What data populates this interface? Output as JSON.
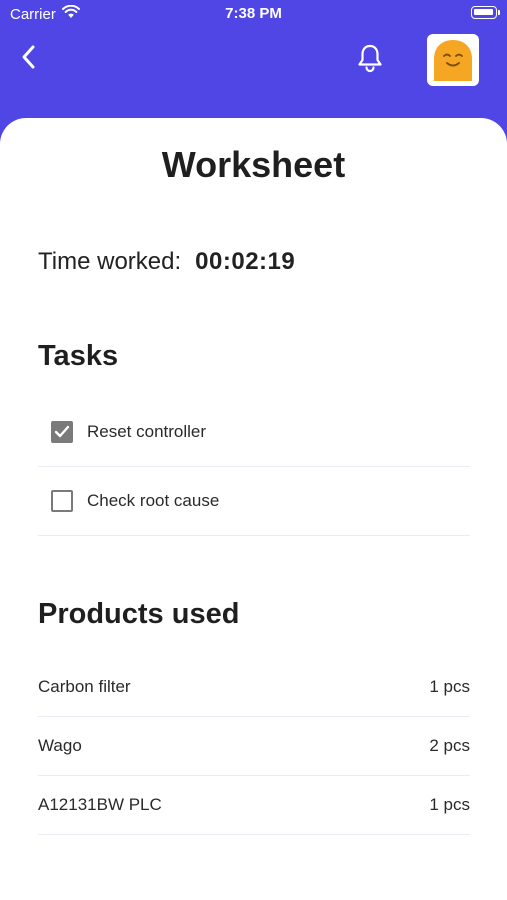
{
  "status_bar": {
    "carrier": "Carrier",
    "time": "7:38 PM",
    "icons": [
      "wifi-icon",
      "battery-icon"
    ]
  },
  "header": {
    "background_color": "#4f46e5",
    "back_icon": "chevron-left-icon",
    "notification_icon": "bell-icon",
    "avatar_color": "#f5a623"
  },
  "page": {
    "title": "Worksheet",
    "time_worked_label": "Time worked:",
    "time_worked_value": "00:02:19"
  },
  "tasks": {
    "heading": "Tasks",
    "items": [
      {
        "label": "Reset controller",
        "checked": true
      },
      {
        "label": "Check root cause",
        "checked": false
      }
    ]
  },
  "products": {
    "heading": "Products used",
    "items": [
      {
        "name": "Carbon filter",
        "quantity": "1 pcs"
      },
      {
        "name": "Wago",
        "quantity": "2 pcs"
      },
      {
        "name": "A12131BW PLC",
        "quantity": "1 pcs"
      }
    ]
  }
}
